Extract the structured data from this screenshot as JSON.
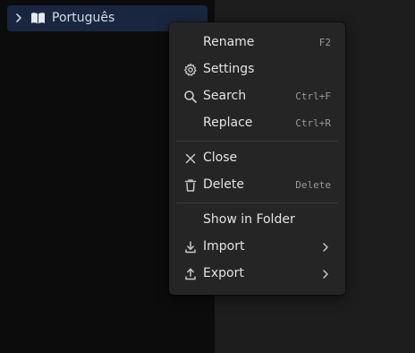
{
  "tree": {
    "item_label": "Português",
    "chevron_icon": "chevron-right-icon",
    "book_icon": "book-open-icon",
    "selected_bg": "#1a2640"
  },
  "context_menu": {
    "items": [
      {
        "label": "Rename",
        "shortcut": "F2",
        "icon": ""
      },
      {
        "label": "Settings",
        "shortcut": "",
        "icon": "gear-icon"
      },
      {
        "label": "Search",
        "shortcut": "Ctrl+F",
        "icon": "search-icon"
      },
      {
        "label": "Replace",
        "shortcut": "Ctrl+R",
        "icon": ""
      },
      {
        "label": "Close",
        "shortcut": "",
        "icon": "close-icon"
      },
      {
        "label": "Delete",
        "shortcut": "Delete",
        "icon": "trash-icon"
      },
      {
        "label": "Show in Folder",
        "shortcut": "",
        "icon": ""
      },
      {
        "label": "Import",
        "shortcut": "",
        "icon": "import-icon",
        "submenu": true
      },
      {
        "label": "Export",
        "shortcut": "",
        "icon": "export-icon",
        "submenu": true
      }
    ]
  },
  "colors": {
    "menu_bg": "#252526",
    "text": "#e3e3e3",
    "shortcut_text": "#9a9a9a",
    "icon": "#c8c8c8"
  }
}
